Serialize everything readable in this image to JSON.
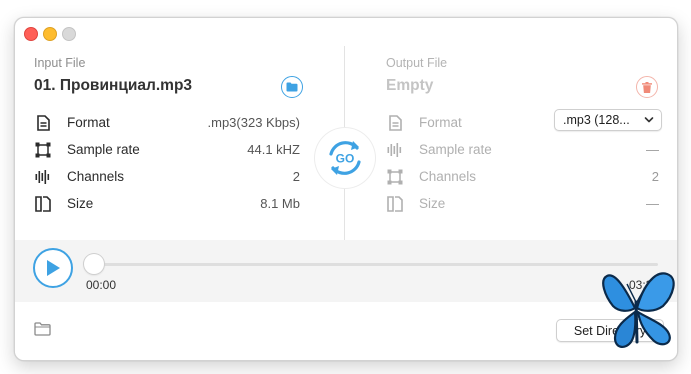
{
  "window": {
    "controls": [
      "close",
      "minimize",
      "zoom"
    ]
  },
  "input": {
    "section_label": "Input File",
    "file_name": "01. Провинциал.mp3",
    "rows": [
      {
        "icon": "document-icon",
        "label": "Format",
        "value": ".mp3(323 Kbps)"
      },
      {
        "icon": "sample-rate-icon",
        "label": "Sample rate",
        "value": "44.1 kHZ"
      },
      {
        "icon": "waveform-icon",
        "label": "Channels",
        "value": "2"
      },
      {
        "icon": "file-size-icon",
        "label": "Size",
        "value": "8.1 Mb"
      }
    ]
  },
  "output": {
    "section_label": "Output File",
    "file_name": "Empty",
    "format_selected": ".mp3 (128...",
    "rows": [
      {
        "icon": "document-icon",
        "label": "Format",
        "value": ""
      },
      {
        "icon": "waveform-icon",
        "label": "Sample rate",
        "value": "—"
      },
      {
        "icon": "sample-rate-icon",
        "label": "Channels",
        "value": "2"
      },
      {
        "icon": "file-size-icon",
        "label": "Size",
        "value": "—"
      }
    ]
  },
  "go_button": {
    "label": "GO"
  },
  "player": {
    "current_time": "00:00",
    "total_time": "03:30",
    "progress": 0
  },
  "footer": {
    "set_directory_label": "Set Directory"
  },
  "colors": {
    "accent": "#3ea2e3",
    "trash": "#f08a78",
    "close": "#ff5f57",
    "minimize": "#febc2e"
  }
}
